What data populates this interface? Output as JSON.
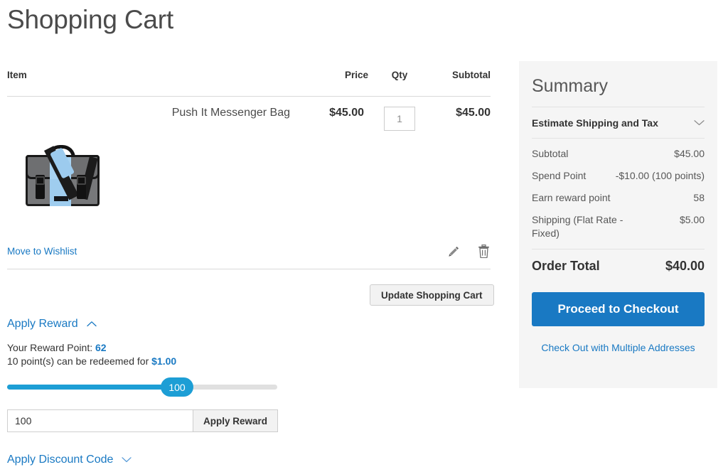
{
  "page": {
    "title": "Shopping Cart"
  },
  "cart_table": {
    "headers": {
      "item": "Item",
      "price": "Price",
      "qty": "Qty",
      "subtotal": "Subtotal"
    },
    "rows": [
      {
        "name": "Push It Messenger Bag",
        "price": "$45.00",
        "qty": "1",
        "subtotal": "$45.00",
        "thumb_icon": "messenger-bag-image"
      }
    ],
    "row_actions": {
      "wishlist_label": "Move to Wishlist",
      "edit_icon": "pencil-icon",
      "delete_icon": "trash-icon"
    },
    "update_button": "Update Shopping Cart"
  },
  "apply_reward": {
    "title": "Apply Reward",
    "chevron_icon": "chevron-up-icon",
    "expanded": true,
    "your_points_label": "Your Reward Point:",
    "your_points_value": "62",
    "redeem_text_prefix": "10 point(s) can be redeemed for",
    "redeem_value": "$1.00",
    "slider": {
      "value": "100",
      "min": 0,
      "max": 160,
      "fill_percent": 63
    },
    "input_value": "100",
    "input_placeholder": "",
    "apply_button": "Apply Reward"
  },
  "apply_discount": {
    "title": "Apply Discount Code",
    "chevron_icon": "chevron-down-icon",
    "expanded": false
  },
  "summary": {
    "title": "Summary",
    "estimate": {
      "label": "Estimate Shipping and Tax",
      "chevron_icon": "chevron-down-icon"
    },
    "totals": [
      {
        "label": "Subtotal",
        "value": "$45.00"
      },
      {
        "label": "Spend Point",
        "value": "-$10.00 (100 points)"
      },
      {
        "label": "Earn reward point",
        "value": "58"
      },
      {
        "label": "Shipping (Flat Rate - Fixed)",
        "value": "$5.00"
      }
    ],
    "grand_total": {
      "label": "Order Total",
      "value": "$40.00"
    },
    "checkout_button": "Proceed to Checkout",
    "multi_address_link": "Check Out with Multiple Addresses"
  },
  "colors": {
    "link": "#1979c3",
    "button_primary": "#1979c3",
    "slider": "#1d9ed5",
    "panel_bg": "#f5f5f5",
    "text": "#333333",
    "muted_text": "#575757",
    "border": "#d9d9d9"
  }
}
